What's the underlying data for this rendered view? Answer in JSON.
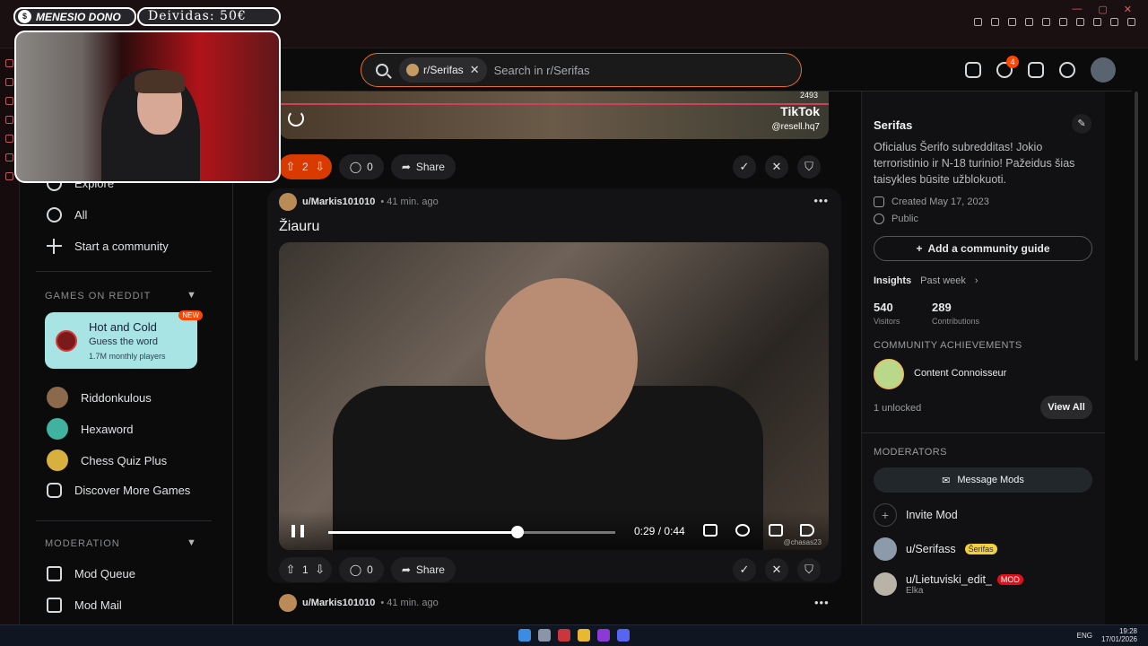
{
  "header": {
    "search_chip": "r/Serifas",
    "search_placeholder": "Search in r/Serifas",
    "notification_count": "4",
    "icons": [
      "advertise-icon",
      "chat-icon",
      "create-post-icon",
      "notification-bell-icon",
      "user-avatar"
    ]
  },
  "left_sidebar": {
    "explore": "Explore",
    "all": "All",
    "start_community": "Start a community",
    "games_section": "GAMES ON REDDIT",
    "featured_game": {
      "title": "Hot and Cold",
      "subtitle": "Guess the word",
      "players": "1.7M monthly players",
      "badge": "NEW"
    },
    "games": [
      "Riddonkulous",
      "Hexaword",
      "Chess Quiz Plus",
      "Discover More Games"
    ],
    "moderation_section": "MODERATION",
    "moderation_items": [
      "Mod Queue",
      "Mod Mail"
    ]
  },
  "feed": {
    "prev_post": {
      "votes": "2",
      "comments": "0",
      "share": "Share",
      "tiktok_label": "TikTok",
      "tiktok_handle": "@resell.hq7",
      "view_count": "2493"
    },
    "post": {
      "author": "u/Markis101010",
      "time": "• 41 min. ago",
      "title": "Žiauru",
      "video_time": "0:29 / 0:44",
      "video_progress": 0.66,
      "watermark": "@chasas23",
      "votes": "1",
      "comments": "0",
      "share": "Share"
    },
    "next_post": {
      "author": "u/Markis101010",
      "time": "• 41 min. ago"
    }
  },
  "right_sidebar": {
    "community_name": "Serifas",
    "description": "Oficialus Šerifo subredditas! Jokio terroristinio ir N-18 turinio! Pažeidus šias taisykles būsite užblokuoti.",
    "created": "Created May 17, 2023",
    "visibility": "Public",
    "guide_button": "Add a community guide",
    "insights_label": "Insights",
    "insights_period": "Past week",
    "visitors": "540",
    "visitors_label": "Visitors",
    "contributions": "289",
    "contributions_label": "Contributions",
    "achievements_label": "COMMUNITY ACHIEVEMENTS",
    "achievement": "Content Connoisseur",
    "unlocked": "1 unlocked",
    "view_all": "View All",
    "moderators_label": "MODERATORS",
    "message_mods": "Message Mods",
    "invite_mod": "Invite Mod",
    "mods": [
      {
        "name": "u/Serifass",
        "flair": "Šerifas"
      },
      {
        "name": "u/Lietuviski_edit_",
        "flair": "MOD",
        "sub": "Elka"
      }
    ]
  },
  "overlay": {
    "name": "MENESIO DONO",
    "coin": "$",
    "debt": "Deividas: 50€"
  },
  "taskbar": {
    "lang": "ENG",
    "time": "19:28",
    "date": "17/01/2026"
  },
  "colors": {
    "accent": "#ff4500",
    "search_border": "#e86d2a",
    "upvote_active": "#d93a00",
    "game_card": "#a8e4e4"
  }
}
